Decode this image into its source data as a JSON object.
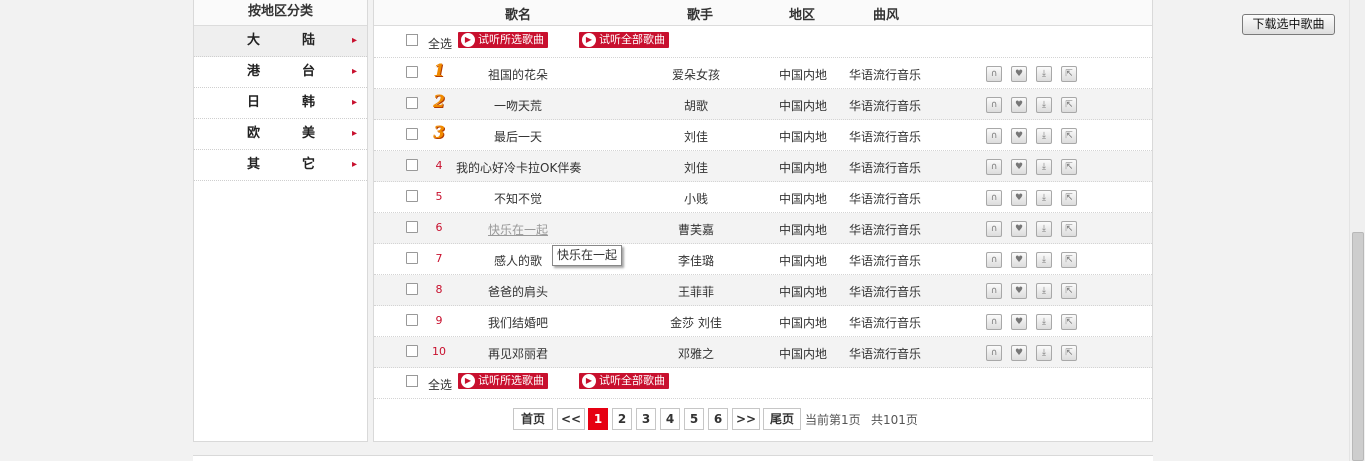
{
  "sidebar": {
    "title": "按地区分类",
    "regions": [
      {
        "c1": "大",
        "c2": "陆",
        "active": true
      },
      {
        "c1": "港",
        "c2": "台"
      },
      {
        "c1": "日",
        "c2": "韩"
      },
      {
        "c1": "欧",
        "c2": "美"
      },
      {
        "c1": "其",
        "c2": "它"
      }
    ],
    "arrow_glyph": "▸"
  },
  "table": {
    "headers": {
      "song": "歌名",
      "singer": "歌手",
      "area": "地区",
      "genre": "曲风"
    },
    "select_all_label": "全选",
    "listen_selected_label": "试听所选歌曲",
    "listen_all_label": "试听全部歌曲",
    "rows": [
      {
        "rank": "1",
        "song": "祖国的花朵",
        "singer": "爱朵女孩",
        "area": "中国内地",
        "genre": "华语流行音乐"
      },
      {
        "rank": "2",
        "song": "一吻天荒",
        "singer": "胡歌",
        "area": "中国内地",
        "genre": "华语流行音乐"
      },
      {
        "rank": "3",
        "song": "最后一天",
        "singer": "刘佳",
        "area": "中国内地",
        "genre": "华语流行音乐"
      },
      {
        "rank": "4",
        "song": "我的心好冷卡拉OK伴奏",
        "singer": "刘佳",
        "area": "中国内地",
        "genre": "华语流行音乐"
      },
      {
        "rank": "5",
        "song": "不知不觉",
        "singer": "小贱",
        "area": "中国内地",
        "genre": "华语流行音乐"
      },
      {
        "rank": "6",
        "song": "快乐在一起",
        "singer": "曹芙嘉",
        "area": "中国内地",
        "genre": "华语流行音乐"
      },
      {
        "rank": "7",
        "song": "感人的歌",
        "singer": "李佳璐",
        "area": "中国内地",
        "genre": "华语流行音乐"
      },
      {
        "rank": "8",
        "song": "爸爸的肩头",
        "singer": "王菲菲",
        "area": "中国内地",
        "genre": "华语流行音乐"
      },
      {
        "rank": "9",
        "song": "我们结婚吧",
        "singer": "金莎 刘佳",
        "area": "中国内地",
        "genre": "华语流行音乐"
      },
      {
        "rank": "10",
        "song": "再见邓丽君",
        "singer": "邓雅之",
        "area": "中国内地",
        "genre": "华语流行音乐"
      }
    ],
    "row_icons": [
      {
        "name": "listen-icon",
        "glyph": "∩"
      },
      {
        "name": "favorite-icon",
        "glyph": "♥"
      },
      {
        "name": "download-icon",
        "glyph": "⤓"
      },
      {
        "name": "share-icon",
        "glyph": "⇱"
      }
    ]
  },
  "tooltip": {
    "text": "快乐在一起"
  },
  "pagination": {
    "first": "首页",
    "prev": "<<",
    "pages": [
      "1",
      "2",
      "3",
      "4",
      "5",
      "6"
    ],
    "current": "1",
    "next": ">>",
    "last": "尾页",
    "current_text": "当前第1页",
    "total_text": "共101页"
  },
  "download_selected_label": "下载选中歌曲",
  "colors": {
    "accent_red": "#c8102e",
    "page_current": "#e60012",
    "rank_gold": "#f08a00"
  }
}
